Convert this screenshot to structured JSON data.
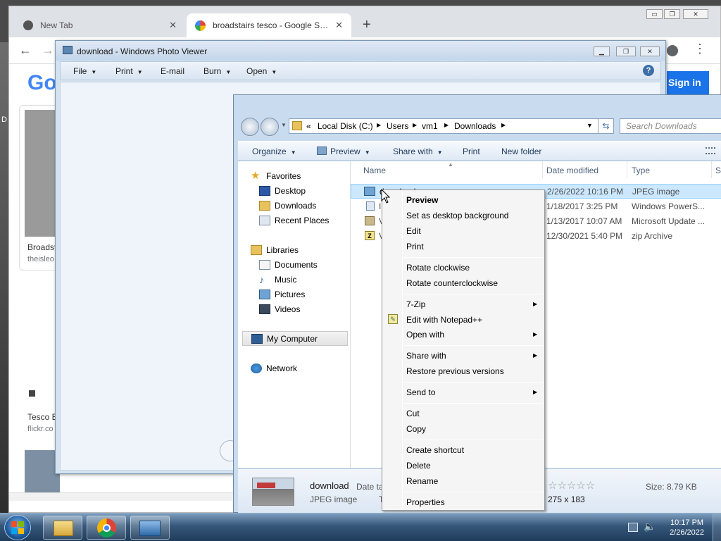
{
  "desktop": {
    "edge_text": "D"
  },
  "chrome": {
    "tabs": [
      {
        "title": "New Tab",
        "close": "✕"
      },
      {
        "title": "broadstairs tesco - Google Search",
        "close": "✕"
      }
    ],
    "new_tab": "+",
    "window_buttons": [
      "▭",
      "❐",
      "✕"
    ],
    "nav": {
      "back": "←",
      "forward": "→"
    },
    "page": {
      "logo": "Go",
      "signin_label": "Sign in",
      "result1_title": "Broadst",
      "result1_source": "theisleo",
      "result2_title": "Tesco B",
      "result2_source": "flickr.co"
    }
  },
  "photo_viewer": {
    "title": "download - Windows Photo Viewer",
    "menu": [
      "File",
      "Print",
      "E-mail",
      "Burn",
      "Open"
    ],
    "help": "?"
  },
  "explorer": {
    "breadcrumb": [
      "«",
      "Local Disk (C:)",
      "Users",
      "vm1",
      "Downloads"
    ],
    "search_placeholder": "Search Downloads",
    "toolbar": [
      "Organize",
      "Preview",
      "Share with",
      "Print",
      "New folder"
    ],
    "nav": {
      "favorites_header": "Favorites",
      "favorites": [
        "Desktop",
        "Downloads",
        "Recent Places"
      ],
      "libraries_header": "Libraries",
      "libraries": [
        "Documents",
        "Music",
        "Pictures",
        "Videos"
      ],
      "computer": "My Computer",
      "network": "Network"
    },
    "columns": {
      "name": "Name",
      "date": "Date modified",
      "type": "Type",
      "size": "S"
    },
    "files": [
      {
        "name": "download",
        "date": "2/26/2022 10:16 PM",
        "type": "JPEG image"
      },
      {
        "name": "I",
        "date": "1/18/2017 3:25 PM",
        "type": "Windows PowerS..."
      },
      {
        "name": "V",
        "date": "1/13/2017 10:07 AM",
        "type": "Microsoft Update ..."
      },
      {
        "name": "V",
        "date": "12/30/2021 5:40 PM",
        "type": "zip Archive"
      }
    ],
    "details": {
      "name": "download",
      "kind": "JPEG image",
      "date_label": "Date ta",
      "t_label": "T",
      "rating": "☆☆☆☆☆",
      "size": "Size: 8.79 KB",
      "dimensions": "275 x 183"
    }
  },
  "context_menu": {
    "items": [
      {
        "label": "Preview",
        "bold": true
      },
      {
        "label": "Set as desktop background"
      },
      {
        "label": "Edit"
      },
      {
        "label": "Print"
      },
      {
        "label": "Rotate clockwise"
      },
      {
        "label": "Rotate counterclockwise"
      },
      {
        "label": "7-Zip",
        "submenu": true
      },
      {
        "label": "Edit with Notepad++"
      },
      {
        "label": "Open with",
        "submenu": true
      },
      {
        "label": "Share with",
        "submenu": true
      },
      {
        "label": "Restore previous versions"
      },
      {
        "label": "Send to",
        "submenu": true
      },
      {
        "label": "Cut"
      },
      {
        "label": "Copy"
      },
      {
        "label": "Create shortcut"
      },
      {
        "label": "Delete"
      },
      {
        "label": "Rename"
      },
      {
        "label": "Properties"
      }
    ],
    "submenu_arrow": "▶"
  },
  "taskbar": {
    "time": "10:17 PM",
    "date": "2/26/2022"
  },
  "colors": {
    "accent": "#1a73e8",
    "selection": "#cce8ff"
  }
}
